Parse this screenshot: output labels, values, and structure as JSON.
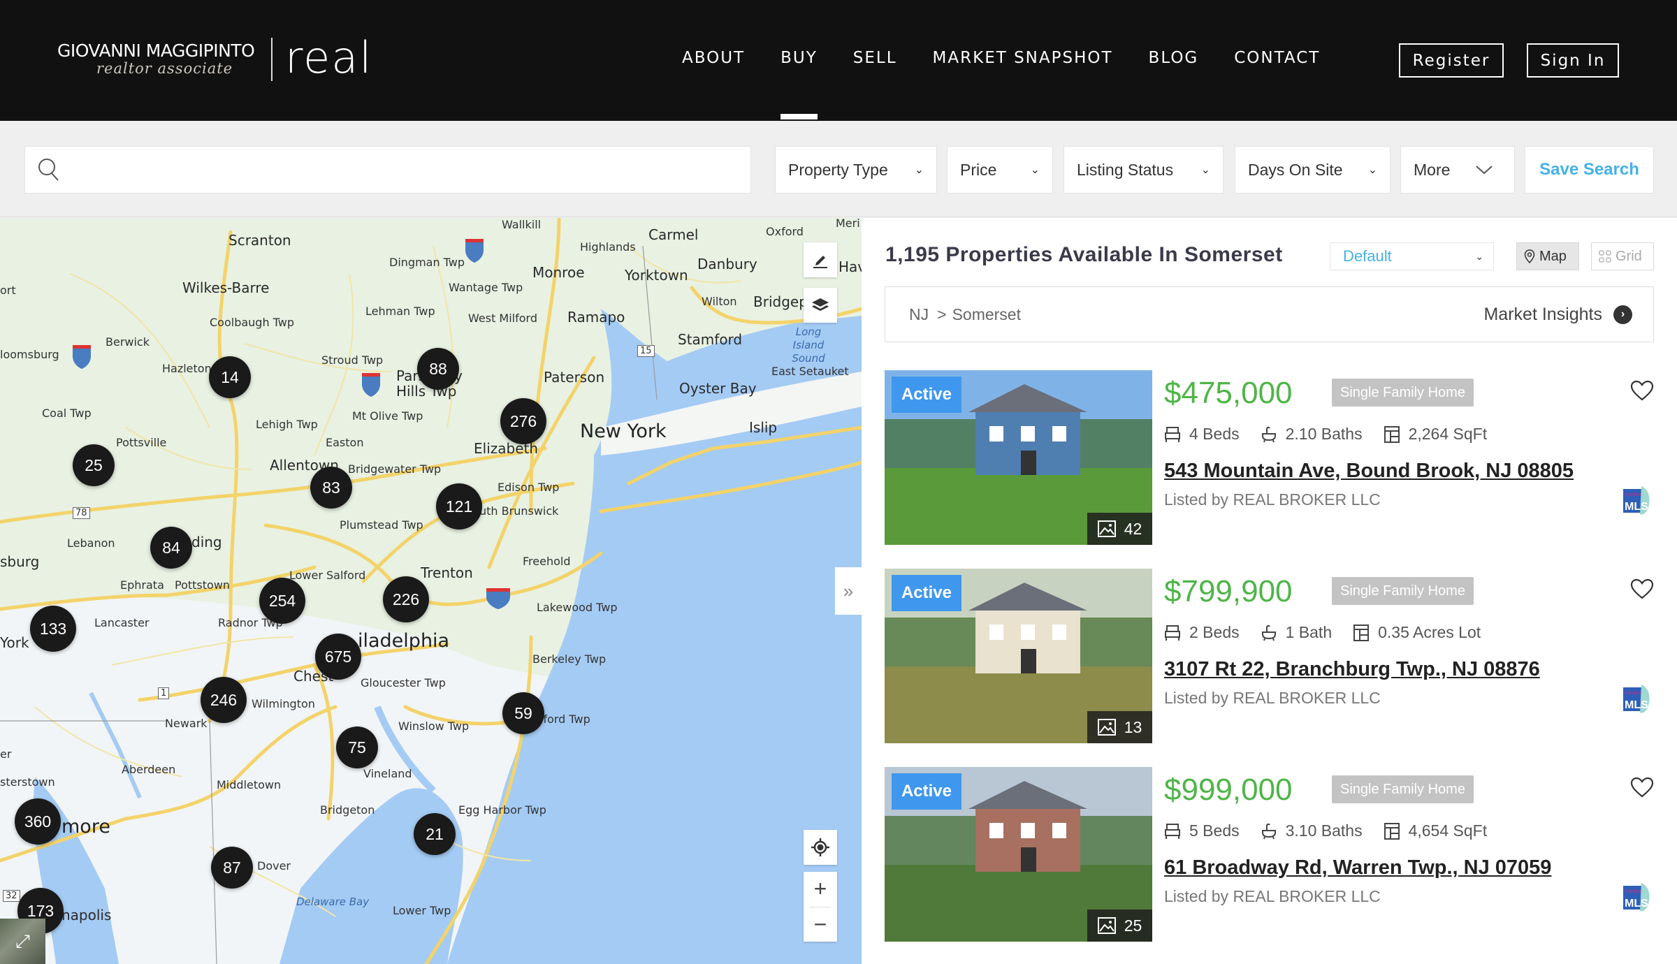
{
  "header": {
    "brand_name": "GIOVANNI MAGGIPINTO",
    "brand_subtitle": "realtor associate",
    "brand_company": "real",
    "nav": [
      {
        "label": "ABOUT",
        "active": false
      },
      {
        "label": "BUY",
        "active": true
      },
      {
        "label": "SELL",
        "active": false
      },
      {
        "label": "MARKET SNAPSHOT",
        "active": false
      },
      {
        "label": "BLOG",
        "active": false
      },
      {
        "label": "CONTACT",
        "active": false
      }
    ],
    "register_label": "Register",
    "signin_label": "Sign In"
  },
  "filters": {
    "search_value": "",
    "search_placeholder": "",
    "property_type": "Property Type",
    "price": "Price",
    "listing_status": "Listing Status",
    "days_on_site": "Days On Site",
    "more": "More",
    "save_search": "Save Search"
  },
  "map": {
    "labels": [
      {
        "text": "Scranton",
        "size": "med"
      },
      {
        "text": "Wilkes-Barre",
        "size": "med"
      },
      {
        "text": "Dingman Twp",
        "size": ""
      },
      {
        "text": "Lehman Twp",
        "size": ""
      },
      {
        "text": "Coolbaugh Twp",
        "size": ""
      },
      {
        "text": "Berwick",
        "size": ""
      },
      {
        "text": "loomsburg",
        "size": ""
      },
      {
        "text": "Hazleton",
        "size": ""
      },
      {
        "text": "Stroud Twp",
        "size": ""
      },
      {
        "text": "Coal Twp",
        "size": ""
      },
      {
        "text": "Lehigh Twp",
        "size": ""
      },
      {
        "text": "Mt Olive Twp",
        "size": ""
      },
      {
        "text": "Pottsville",
        "size": ""
      },
      {
        "text": "Easton",
        "size": ""
      },
      {
        "text": "Allentown",
        "size": "med"
      },
      {
        "text": "Bridgewater Twp",
        "size": ""
      },
      {
        "text": "Pars    -Troy",
        "size": ""
      },
      {
        "text": "Hills Twp",
        "size": ""
      },
      {
        "text": "Plumstead Twp",
        "size": ""
      },
      {
        "text": "Lebanon",
        "size": ""
      },
      {
        "text": "sburg",
        "size": ""
      },
      {
        "text": "ding",
        "size": ""
      },
      {
        "text": "Ephrata",
        "size": ""
      },
      {
        "text": "Pottstown",
        "size": ""
      },
      {
        "text": "Lower Salford",
        "size": ""
      },
      {
        "text": "Trenton",
        "size": ""
      },
      {
        "text": "Lancaster",
        "size": ""
      },
      {
        "text": "Radnor Twp",
        "size": ""
      },
      {
        "text": "York",
        "size": ""
      },
      {
        "text": "iladelphia",
        "size": "big"
      },
      {
        "text": "Chest",
        "size": ""
      },
      {
        "text": "Gloucester Twp",
        "size": ""
      },
      {
        "text": "Wilmington",
        "size": ""
      },
      {
        "text": "Newark",
        "size": ""
      },
      {
        "text": "Winslow Twp",
        "size": ""
      },
      {
        "text": "Aberdeen",
        "size": ""
      },
      {
        "text": "sterstown",
        "size": ""
      },
      {
        "text": "Middletown",
        "size": ""
      },
      {
        "text": "Vineland",
        "size": ""
      },
      {
        "text": "Bridgeton",
        "size": ""
      },
      {
        "text": "Egg Harbor Twp",
        "size": ""
      },
      {
        "text": "more",
        "size": "med"
      },
      {
        "text": "Dover",
        "size": ""
      },
      {
        "text": "Delaware Bay",
        "size": "water"
      },
      {
        "text": "Lower Twp",
        "size": ""
      },
      {
        "text": "napolis",
        "size": "med"
      },
      {
        "text": "Wallkill",
        "size": ""
      },
      {
        "text": "Carmel",
        "size": ""
      },
      {
        "text": "Oxford",
        "size": ""
      },
      {
        "text": "Highlands",
        "size": ""
      },
      {
        "text": "Danbury",
        "size": ""
      },
      {
        "text": "Monroe",
        "size": ""
      },
      {
        "text": "Yorktown",
        "size": ""
      },
      {
        "text": "Wantage Twp",
        "size": ""
      },
      {
        "text": "Wilton",
        "size": ""
      },
      {
        "text": "Bridgep",
        "size": "med"
      },
      {
        "text": "West Milford",
        "size": ""
      },
      {
        "text": "Ramapo",
        "size": "med"
      },
      {
        "text": "Long Island Sound",
        "size": "water"
      },
      {
        "text": "Stamford",
        "size": "med"
      },
      {
        "text": "East Setauket",
        "size": ""
      },
      {
        "text": "Paterson",
        "size": "med"
      },
      {
        "text": "Oyster Bay",
        "size": "med"
      },
      {
        "text": "New York",
        "size": "big"
      },
      {
        "text": "Islip",
        "size": "med"
      },
      {
        "text": "Elizabeth",
        "size": "med"
      },
      {
        "text": "Edison Twp",
        "size": ""
      },
      {
        "text": "uth Brunswick",
        "size": ""
      },
      {
        "text": "Freehold",
        "size": ""
      },
      {
        "text": "Lakewood Twp",
        "size": ""
      },
      {
        "text": "Berkeley Twp",
        "size": ""
      },
      {
        "text": "fford Twp",
        "size": ""
      },
      {
        "text": "Meri",
        "size": ""
      },
      {
        "text": "Hav",
        "size": "med"
      },
      {
        "text": "ort",
        "size": ""
      },
      {
        "text": "er",
        "size": ""
      }
    ],
    "clusters": [
      {
        "count": "14"
      },
      {
        "count": "88"
      },
      {
        "count": "276"
      },
      {
        "count": "25"
      },
      {
        "count": "83"
      },
      {
        "count": "121"
      },
      {
        "count": "84"
      },
      {
        "count": "254"
      },
      {
        "count": "226"
      },
      {
        "count": "133"
      },
      {
        "count": "675"
      },
      {
        "count": "246"
      },
      {
        "count": "59"
      },
      {
        "count": "75"
      },
      {
        "count": "360"
      },
      {
        "count": "21"
      },
      {
        "count": "87"
      },
      {
        "count": "173"
      }
    ],
    "route_shields": [
      "78",
      "15",
      "1",
      "32"
    ],
    "controls": {
      "zoom_in": "+",
      "zoom_out": "−",
      "collapse": "»"
    }
  },
  "results": {
    "title": "1,195 Properties Available In Somerset",
    "sort_value": "Default",
    "view_map_label": "Map",
    "view_grid_label": "Grid",
    "breadcrumb": {
      "state": "NJ",
      "separator": ">",
      "county": "Somerset"
    },
    "market_insights_label": "Market Insights",
    "listings": [
      {
        "status": "Active",
        "price": "$475,000",
        "type": "Single Family Home",
        "beds": "4 Beds",
        "baths": "2.10 Baths",
        "size": "2,264 SqFt",
        "address": "543 Mountain Ave, Bound Brook, NJ 08805",
        "listed_by": "Listed by REAL BROKER LLC",
        "photo_count": "42",
        "colors": {
          "sky": "#7fb3e8",
          "ground": "#5a9a3a",
          "house": "#4f7fb0"
        }
      },
      {
        "status": "Active",
        "price": "$799,900",
        "type": "Single Family Home",
        "beds": "2 Beds",
        "baths": "1 Bath",
        "size": "0.35 Acres Lot",
        "address": "3107 Rt 22, Branchburg Twp., NJ 08876",
        "listed_by": "Listed by REAL BROKER LLC",
        "photo_count": "13",
        "colors": {
          "sky": "#c7d3c0",
          "ground": "#8d8c4a",
          "house": "#e8e2cf"
        }
      },
      {
        "status": "Active",
        "price": "$999,000",
        "type": "Single Family Home",
        "beds": "5 Beds",
        "baths": "3.10 Baths",
        "size": "4,654 SqFt",
        "address": "61 Broadway Rd, Warren Twp., NJ 07059",
        "listed_by": "Listed by REAL BROKER LLC",
        "photo_count": "25",
        "colors": {
          "sky": "#b9c6d3",
          "ground": "#4f7a3a",
          "house": "#a87060"
        }
      }
    ]
  },
  "colors": {
    "header_bg": "#111111",
    "accent_blue": "#45b1e8",
    "price_green": "#4fb548",
    "active_badge": "#3f97ee",
    "cluster": "#1a1a1a",
    "water": "#a4cbf4",
    "land": "#e8f1e2"
  }
}
